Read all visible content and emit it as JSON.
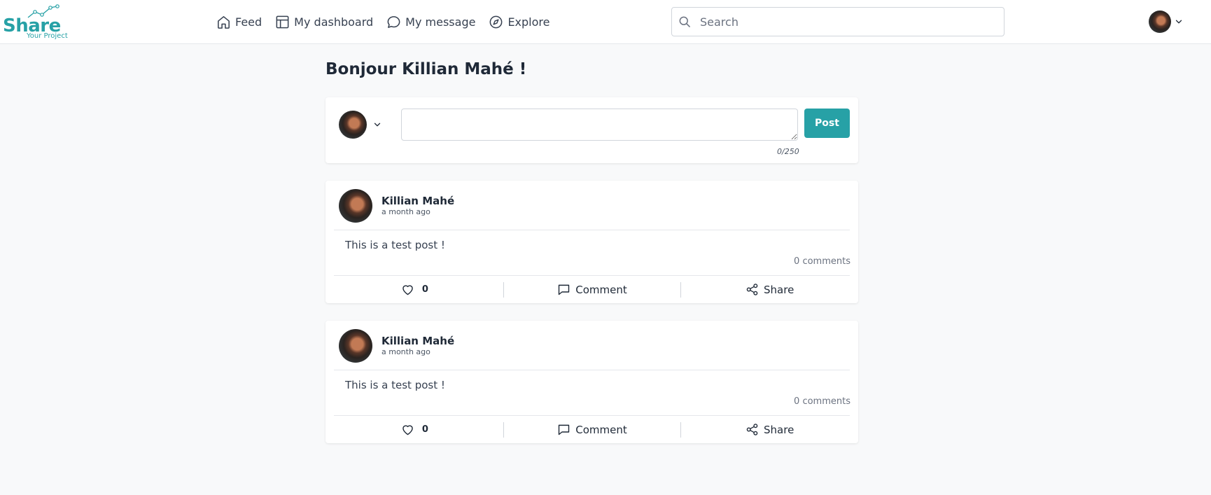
{
  "brand": {
    "name": "Share",
    "tagline": "Your Project",
    "color": "#27a1a6"
  },
  "nav": {
    "items": [
      {
        "label": "Feed",
        "icon": "home-icon"
      },
      {
        "label": "My dashboard",
        "icon": "dashboard-icon"
      },
      {
        "label": "My message",
        "icon": "message-icon"
      },
      {
        "label": "Explore",
        "icon": "compass-icon"
      }
    ]
  },
  "search": {
    "placeholder": "Search",
    "value": ""
  },
  "user": {
    "avatar": "user-avatar"
  },
  "greeting": "Bonjour Killian Mahé !",
  "composer": {
    "value": "",
    "counter": "0/250",
    "post_label": "Post"
  },
  "posts": [
    {
      "author": "Killian Mahé",
      "time": "a month ago",
      "content": "This is a test post !",
      "comments": "0 comments",
      "likes": "0",
      "comment_label": "Comment",
      "share_label": "Share"
    },
    {
      "author": "Killian Mahé",
      "time": "a month ago",
      "content": "This is a test post !",
      "comments": "0 comments",
      "likes": "0",
      "comment_label": "Comment",
      "share_label": "Share"
    }
  ]
}
